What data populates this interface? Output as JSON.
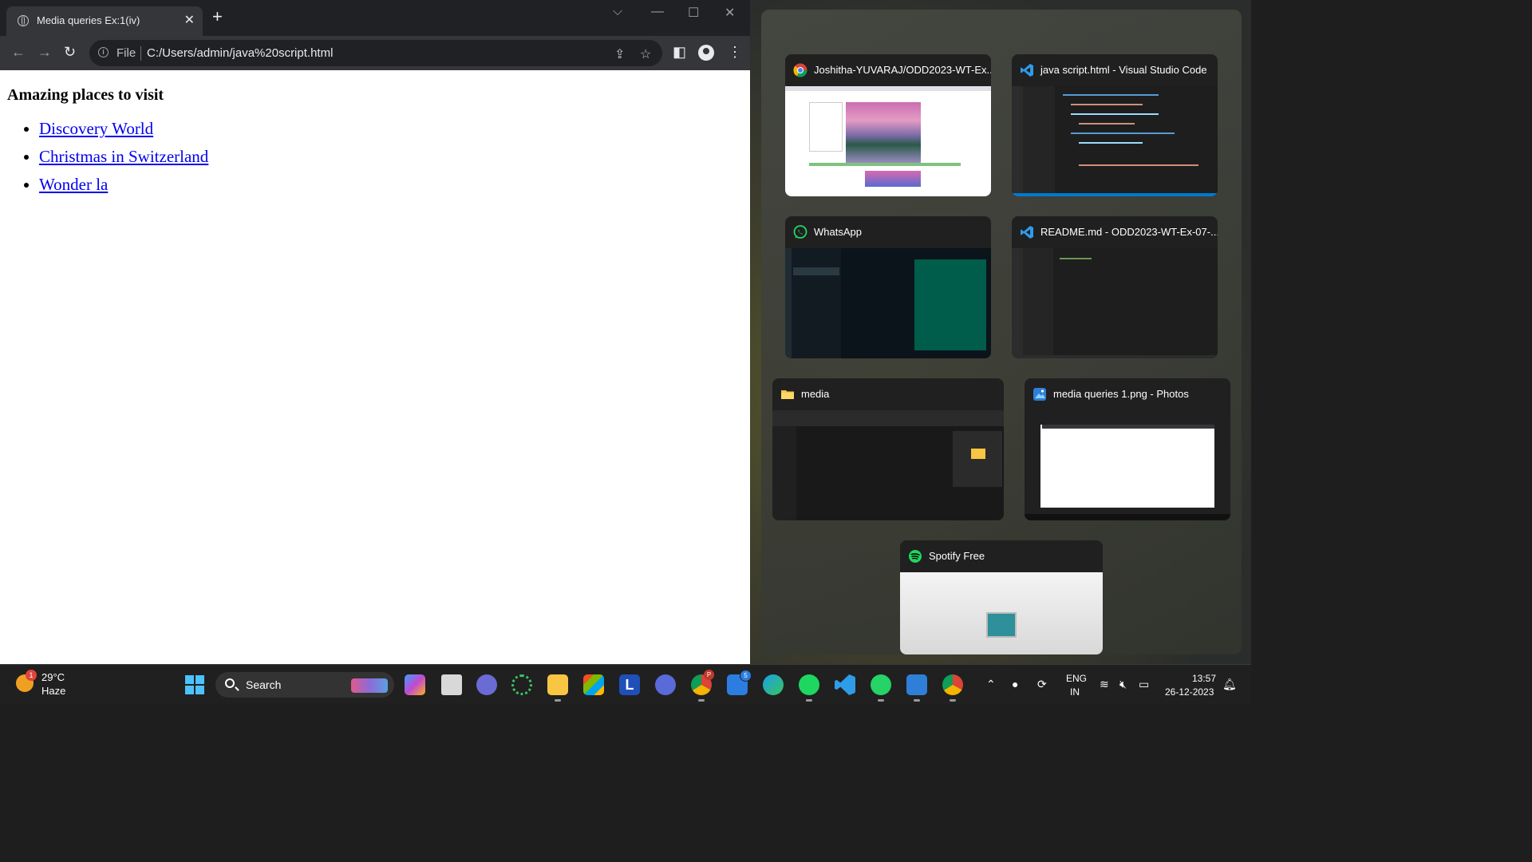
{
  "browser": {
    "tab_title": "Media queries Ex:1(iv)",
    "new_tab_glyph": "+",
    "close_glyph": "✕",
    "scheme_label": "File",
    "url": "C:/Users/admin/java%20script.html",
    "page": {
      "heading": "Amazing places to visit",
      "links": [
        "Discovery World",
        "Christmas in Switzerland",
        "Wonder la"
      ]
    }
  },
  "snap": {
    "windows": [
      {
        "title": "Joshitha-YUVARAJ/ODD2023-WT-Ex...",
        "icon": "chrome-icon"
      },
      {
        "title": "java script.html - Visual Studio Code",
        "icon": "vscode-icon"
      },
      {
        "title": "WhatsApp",
        "icon": "whatsapp-icon"
      },
      {
        "title": "README.md - ODD2023-WT-Ex-07-...",
        "icon": "vscode-icon"
      },
      {
        "title": "media",
        "icon": "folder-icon"
      },
      {
        "title": "media queries 1.png - Photos",
        "icon": "photos-icon"
      },
      {
        "title": "Spotify Free",
        "icon": "spotify-icon"
      }
    ]
  },
  "taskbar": {
    "weather": {
      "temp": "29°C",
      "condition": "Haze",
      "badge": "1"
    },
    "search_label": "Search",
    "store_badge": "5",
    "chrome_profile_badge": "P",
    "language": {
      "line1": "ENG",
      "line2": "IN"
    },
    "clock": {
      "time": "13:57",
      "date": "26-12-2023"
    }
  },
  "colors": {
    "link": "#0000ee",
    "accent": "#4cc2ff",
    "chrome_dark": "#202124"
  }
}
